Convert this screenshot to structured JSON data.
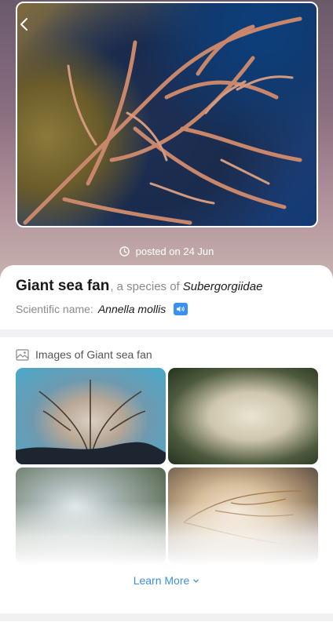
{
  "hero": {
    "posted_text": "posted on 24 Jun"
  },
  "species": {
    "common_name": "Giant sea fan",
    "species_prefix": ", a species of",
    "family": "Subergorgiidae",
    "scientific_label": "Scientific name:",
    "scientific_name": "Annella mollis"
  },
  "images": {
    "title": "Images of Giant sea fan",
    "learn_more": "Learn More"
  },
  "icons": [
    "back-arrow-icon",
    "clock-icon",
    "speaker-icon",
    "image-gallery-icon",
    "chevron-down-icon"
  ],
  "colors": {
    "accent_blue": "#3f8ed8",
    "speaker_blue": "#3a8ff3",
    "background": "#f1f1f3"
  }
}
